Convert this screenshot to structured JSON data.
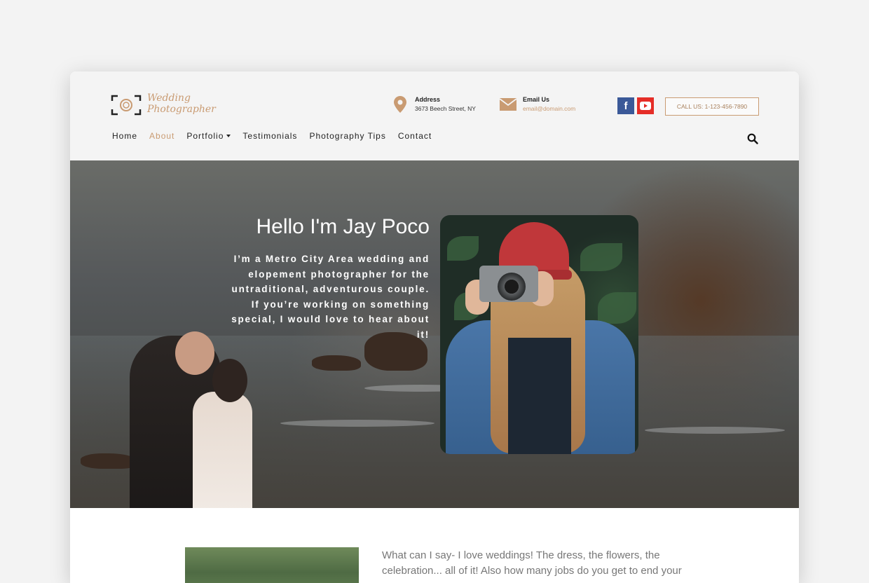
{
  "logo": {
    "line1": "Wedding",
    "line2": "Photographer"
  },
  "header": {
    "address_label": "Address",
    "address_value": "3673 Beech Street, NY",
    "email_label": "Email Us",
    "email_value": "email@domain.com",
    "call_button": "CALL US: 1-123-456-7890",
    "social": [
      "facebook-icon",
      "youtube-icon"
    ]
  },
  "nav": {
    "items": [
      {
        "label": "Home"
      },
      {
        "label": "About",
        "active": true
      },
      {
        "label": "Portfolio",
        "dropdown": true
      },
      {
        "label": "Testimonials"
      },
      {
        "label": "Photography Tips"
      },
      {
        "label": "Contact"
      }
    ]
  },
  "hero": {
    "title": "Hello I'm Jay Poco",
    "text": "I’m a Metro City Area wedding and elopement photographer for the untraditional, adventurous couple. If you’re working on something special, I would love to hear about it!"
  },
  "content": {
    "text": "What can I say- I love weddings! The dress, the flowers, the celebration... all of it! Also how many jobs do you get to end your"
  },
  "colors": {
    "accent": "#c99b72",
    "facebook": "#3b5998",
    "youtube": "#e52d27"
  }
}
